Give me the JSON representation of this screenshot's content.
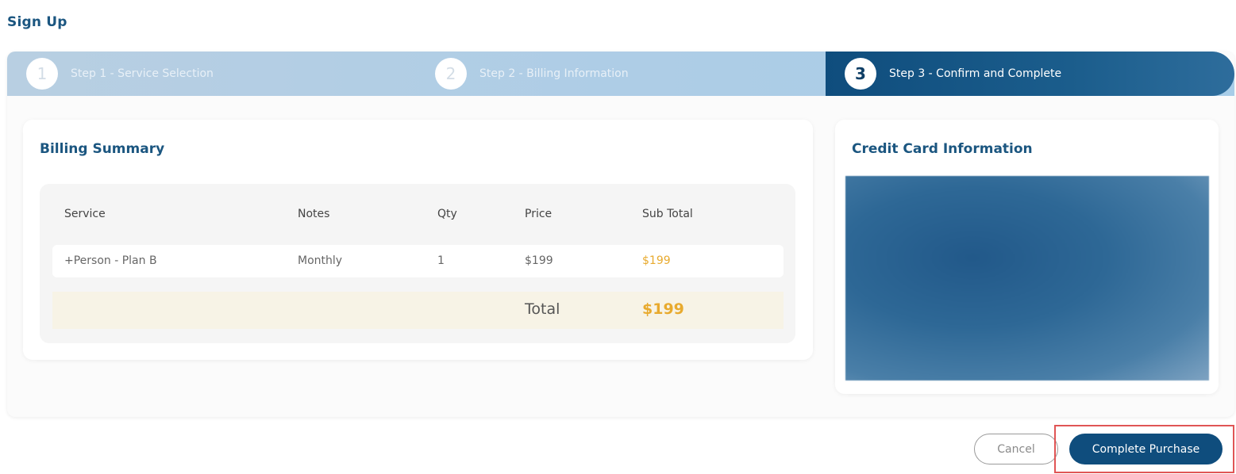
{
  "page": {
    "title": "Sign Up"
  },
  "steps": [
    {
      "number": "1",
      "label": "Step 1 - Service Selection",
      "active": false
    },
    {
      "number": "2",
      "label": "Step 2 - Billing Information",
      "active": false
    },
    {
      "number": "3",
      "label": "Step 3 - Confirm and Complete",
      "active": true
    }
  ],
  "billing": {
    "title": "Billing Summary",
    "columns": [
      "Service",
      "Notes",
      "Qty",
      "Price",
      "Sub Total"
    ],
    "rows": [
      {
        "service": "+Person - Plan B",
        "notes": "Monthly",
        "qty": "1",
        "price": "$199",
        "subtotal": "$199"
      }
    ],
    "total_label": "Total",
    "total_value": "$199"
  },
  "credit_card": {
    "title": "Credit Card Information"
  },
  "actions": {
    "cancel_label": "Cancel",
    "complete_label": "Complete Purchase"
  },
  "colors": {
    "primary": "#0f4d7d",
    "accent": "#e8aa2e",
    "highlight": "#e05555"
  }
}
